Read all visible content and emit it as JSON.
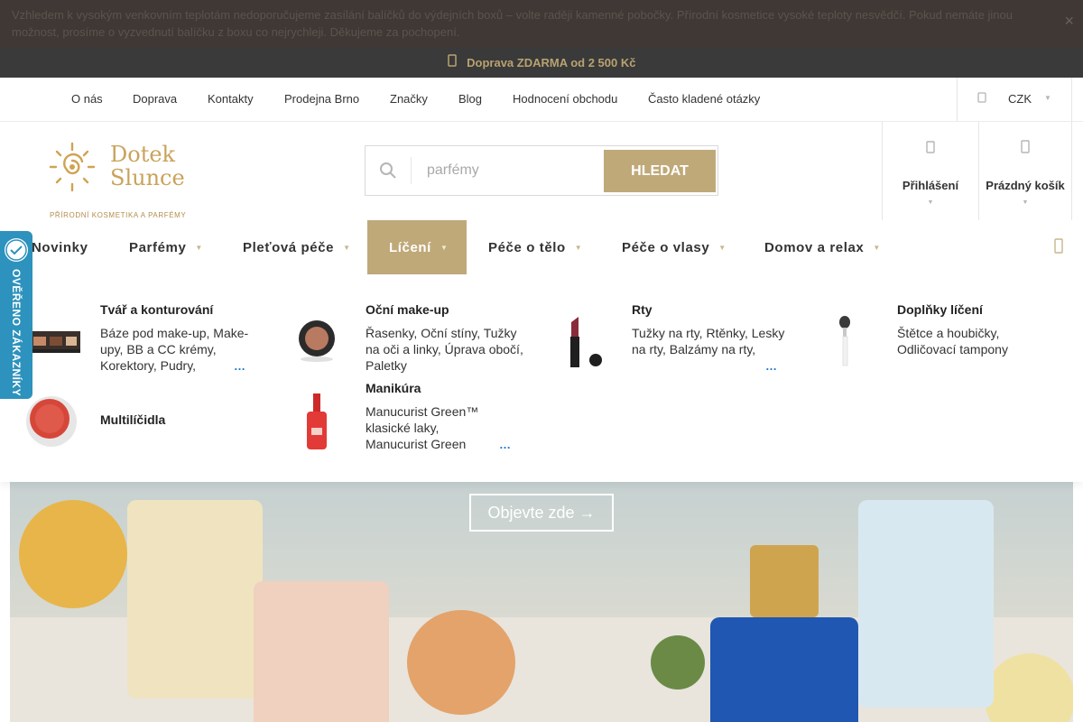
{
  "notice": {
    "text": "Vzhledem k vysokým venkovním teplotám nedoporučujeme zasílání balíčků do výdejních boxů – volte raději kamenné pobočky. Přírodní kosmetice vysoké teploty nesvědčí. Pokud nemáte jinou možnost, prosíme o vyzvednutí balíčku z boxu co nejrychleji. Děkujeme za pochopení.",
    "close_icon": "×"
  },
  "shipping": {
    "icon": "truck-icon",
    "text": "Doprava ZDARMA od 2 500 Kč"
  },
  "toplinks": [
    "O nás",
    "Doprava",
    "Kontakty",
    "Prodejna Brno",
    "Značky",
    "Blog",
    "Hodnocení obchodu",
    "Často kladené otázky"
  ],
  "currency": {
    "label": "CZK"
  },
  "logo": {
    "name_line1": "Dotek",
    "name_line2": "Slunce",
    "tagline": "PŘÍRODNÍ KOSMETIKA A PARFÉMY"
  },
  "search": {
    "placeholder": "parfémy",
    "value": "",
    "button": "HLEDAT"
  },
  "account": {
    "label": "Přihlášení"
  },
  "cart": {
    "label": "Prázdný košík"
  },
  "nav": [
    {
      "label": "Novinky",
      "has_dropdown": false
    },
    {
      "label": "Parfémy",
      "has_dropdown": true
    },
    {
      "label": "Pleťová péče",
      "has_dropdown": true
    },
    {
      "label": "Líčení",
      "has_dropdown": true,
      "active": true
    },
    {
      "label": "Péče o tělo",
      "has_dropdown": true
    },
    {
      "label": "Péče o vlasy",
      "has_dropdown": true
    },
    {
      "label": "Domov a relax",
      "has_dropdown": true
    }
  ],
  "mega_menu": {
    "more_label": "…",
    "categories": [
      {
        "title": "Tvář a konturování",
        "links": "Báze pod make-up, Make-upy, BB a CC krémy, Korektory, Pudry,",
        "has_more": true
      },
      {
        "title": "Oční make-up",
        "links": "Řasenky, Oční stíny, Tužky na oči a linky, Úprava obočí, Paletky",
        "has_more": false
      },
      {
        "title": "Rty",
        "links": "Tužky na rty, Rtěnky, Lesky na rty, Balzámy na rty,",
        "has_more": true
      },
      {
        "title": "Doplňky líčení",
        "links": "Štětce a houbičky, Odličovací tampony",
        "has_more": false
      },
      {
        "title": "Multilíčidla",
        "links": "",
        "has_more": false
      },
      {
        "title": "Manikúra",
        "links": "Manucurist Green™ klasické laky, Manucurist Green Flash",
        "has_more": true
      }
    ]
  },
  "hero": {
    "cta": "Objevte zde →",
    "prev_icon": "▭",
    "next_icon": "▭"
  },
  "badge": {
    "text": "OVĚŘENO ZÁKAZNÍKY"
  },
  "colors": {
    "accent": "#bfa979",
    "dark_bar": "#3a3a3a",
    "badge_blue": "#2d92bd",
    "link_blue": "#1a73c9"
  }
}
